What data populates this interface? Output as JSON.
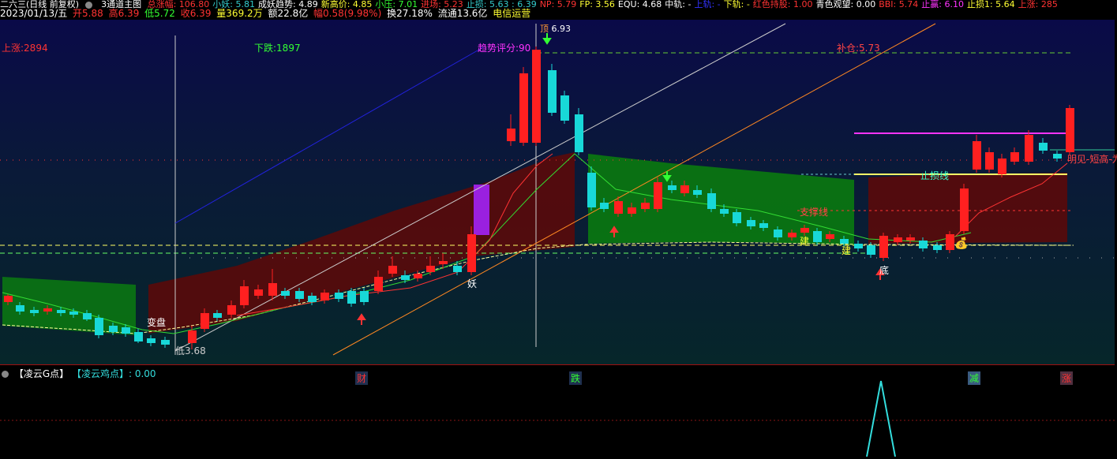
{
  "topbar": {
    "stock_name": "二六三(日线 前复权)",
    "indicator": "3通道主图",
    "items": [
      {
        "label": "总涨幅: 106.80",
        "color": "#ff3333"
      },
      {
        "label": "小妖: 5.81",
        "color": "#33cccc"
      },
      {
        "label": "成妖趋势: 4.89",
        "color": "#ffffff"
      },
      {
        "label": "新高价: 4.85",
        "color": "#ffff33"
      },
      {
        "label": "小压: 7.01",
        "color": "#33ff33"
      },
      {
        "label": "进场: 5.23",
        "color": "#ff3333"
      },
      {
        "label": "止损: 5.63 : 6.39",
        "color": "#33cccc"
      },
      {
        "label": "NP: 5.79",
        "color": "#ff3333"
      },
      {
        "label": "FP: 3.56",
        "color": "#ffff33"
      },
      {
        "label": "EQU: 4.68",
        "color": "#ffffff"
      },
      {
        "label": "中轨: -",
        "color": "#ffffff"
      },
      {
        "label": "上轨: -",
        "color": "#3333ff"
      },
      {
        "label": "下轨: -",
        "color": "#ffff33"
      },
      {
        "label": "红色持股: 1.00",
        "color": "#ff3333"
      },
      {
        "label": "青色观望: 0.00",
        "color": "#ffffff"
      },
      {
        "label": "BBI: 5.74",
        "color": "#ff3333"
      },
      {
        "label": "止赢: 6.10",
        "color": "#ff33ff"
      },
      {
        "label": "止损1: 5.64",
        "color": "#ffff33"
      },
      {
        "label": "上涨: 285",
        "color": "#ff3333"
      }
    ]
  },
  "infobar": {
    "date": "2023/01/13/五",
    "open": "开5.88",
    "high": "高6.39",
    "low": "低5.72",
    "close": "收6.39",
    "volume": "量369.2万",
    "amount": "额22.8亿",
    "change": "幅0.58(9.98%)",
    "turnover": "换27.18%",
    "float": "流通13.6亿",
    "sector": "电信运营"
  },
  "labels": {
    "rise_count": "上涨:2894",
    "fall_count": "下跌:1897",
    "trend_score": "趋势评分:90",
    "top_tag": "顶",
    "top_value": "6.93",
    "buy_price": "补仓:5.73",
    "stop_loss_line": "止损线",
    "support_line": "支撑线",
    "short_high_tag": "明见-短高-为",
    "change_tag": "变盘",
    "low_tag": "低",
    "low_value": "3.68",
    "yao": "妖",
    "bottom": "底",
    "jian1": "建",
    "jian2": "建"
  },
  "xmarkers": [
    {
      "label": "财",
      "color": "#ff3333",
      "bg": "#1f3050",
      "pos": 457
    },
    {
      "label": "跌",
      "color": "#33ff33",
      "bg": "#1f3050",
      "pos": 728
    },
    {
      "label": "减",
      "color": "#33ff33",
      "bg": "#3a5a80",
      "pos": 1233
    },
    {
      "label": "涨",
      "color": "#ff3333",
      "bg": "#503040",
      "pos": 1350
    }
  ],
  "subpanel": {
    "label1": "【凌云G点】",
    "label2": "【凌云鸡点】: 0.00"
  },
  "colors": {
    "up": "#ff2020",
    "down": "#18d8d8",
    "channel_green": "#0a7a10",
    "channel_red": "#5a0a0a",
    "bg_top": "#0a0a48"
  }
}
